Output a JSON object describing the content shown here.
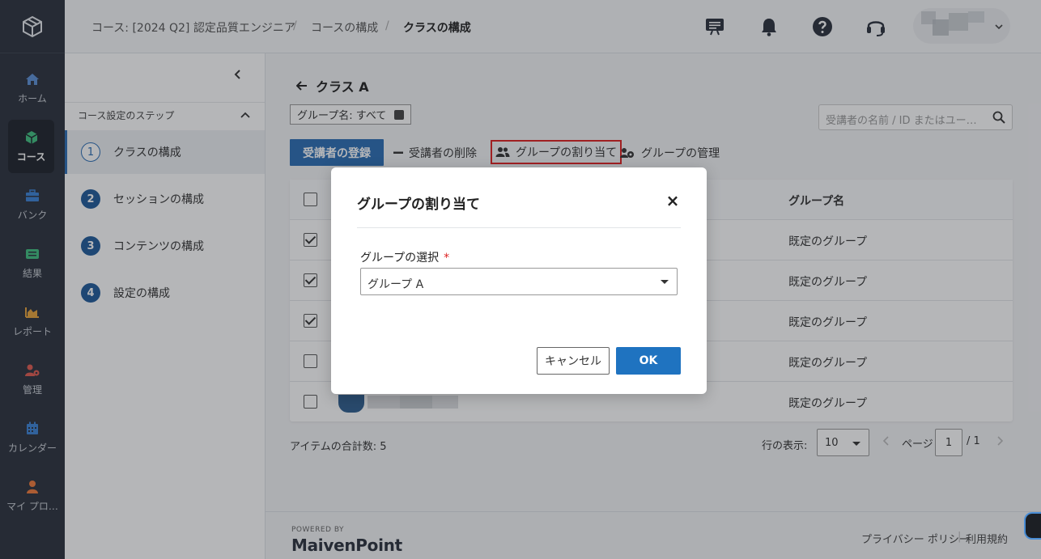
{
  "rail": {
    "items": [
      {
        "label": "ホーム",
        "icon": "home-icon",
        "color": "#5b8fd6"
      },
      {
        "label": "コース",
        "icon": "course-cube-icon",
        "color": "#3fbf7f",
        "active": true
      },
      {
        "label": "バンク",
        "icon": "bank-briefcase-icon",
        "color": "#3b82d6"
      },
      {
        "label": "結果",
        "icon": "results-list-icon",
        "color": "#3fbf7f"
      },
      {
        "label": "レポート",
        "icon": "report-chart-icon",
        "color": "#e8a33a"
      },
      {
        "label": "管理",
        "icon": "admin-user-gear-icon",
        "color": "#e05a4f"
      },
      {
        "label": "カレンダー",
        "icon": "calendar-icon",
        "color": "#3b82d6"
      },
      {
        "label": "マイ プロ…",
        "icon": "profile-user-icon",
        "color": "#f07a3a"
      }
    ]
  },
  "header": {
    "breadcrumb": [
      "コース: [2024 Q2] 認定品質エンジニア",
      "コースの構成",
      "クラスの構成"
    ],
    "separator": "/"
  },
  "steps": {
    "heading": "コース設定のステップ",
    "items": [
      {
        "num": "1",
        "label": "クラスの構成"
      },
      {
        "num": "2",
        "label": "セッションの構成"
      },
      {
        "num": "3",
        "label": "コンテンツの構成"
      },
      {
        "num": "4",
        "label": "設定の構成"
      }
    ]
  },
  "main": {
    "title": "クラス A",
    "group_filter": "グループ名: すべて",
    "search_placeholder": "受講者の名前 / ID またはユー…",
    "toolbar": {
      "enroll": "受講者の登録",
      "remove": "受講者の削除",
      "assign_group": "グループの割り当て",
      "manage_group": "グループの管理"
    },
    "table": {
      "group_header": "グループ名",
      "rows": [
        {
          "checked": true,
          "group": "既定のグループ"
        },
        {
          "checked": true,
          "group": "既定のグループ"
        },
        {
          "checked": true,
          "group": "既定のグループ"
        },
        {
          "checked": false,
          "group": "既定のグループ"
        },
        {
          "checked": false,
          "group": "既定のグループ"
        }
      ]
    },
    "total_items": "アイテムの合計数: 5",
    "rows_per_page_label": "行の表示:",
    "rows_per_page": "10",
    "page_label": "ページ",
    "page_current": "1",
    "page_total": "/ 1"
  },
  "footer": {
    "powered_by": "POWERED BY",
    "brand": "MaivenPoint",
    "privacy": "プライバシー ポリシー",
    "terms": "利用規約",
    "divider": "|"
  },
  "modal": {
    "title": "グループの割り当て",
    "field_label": "グループの選択",
    "required_mark": "*",
    "selected_group": "グループ A",
    "cancel": "キャンセル",
    "ok": "OK"
  }
}
